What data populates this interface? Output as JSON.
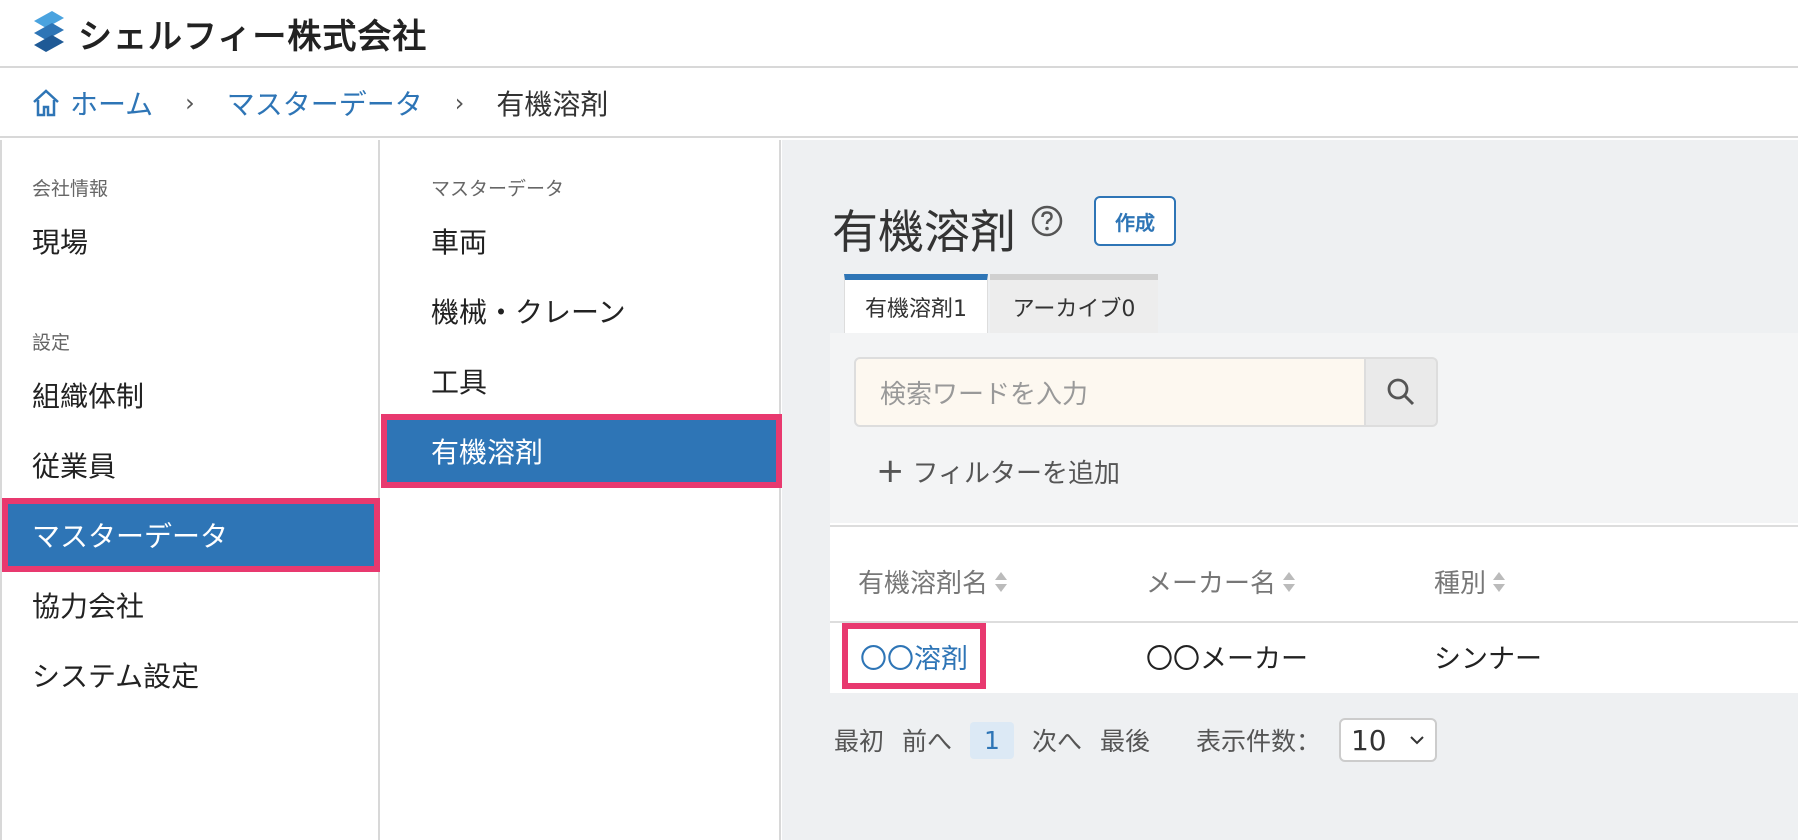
{
  "header": {
    "company": "シェルフィー株式会社"
  },
  "breadcrumb": {
    "home": "ホーム",
    "master": "マスターデータ",
    "current": "有機溶剤"
  },
  "sidebar1": {
    "company_section": "会社情報",
    "site": "現場",
    "settings_section": "設定",
    "org": "組織体制",
    "employees": "従業員",
    "master": "マスターデータ",
    "partner": "協力会社",
    "system": "システム設定"
  },
  "sidebar2": {
    "section": "マスターデータ",
    "items": [
      "車両",
      "機械・クレーン",
      "工具",
      "有機溶剤"
    ]
  },
  "main": {
    "title": "有機溶剤",
    "create": "作成",
    "tabs": [
      "有機溶剤1",
      "アーカイブ0"
    ],
    "search_placeholder": "検索ワードを入力",
    "add_filter": "フィルターを追加",
    "columns": [
      "有機溶剤名",
      "メーカー名",
      "種別"
    ],
    "rows": [
      [
        "〇〇溶剤",
        "〇〇メーカー",
        "シンナー"
      ]
    ],
    "pager": {
      "first": "最初",
      "prev": "前へ",
      "page": "1",
      "next": "次へ",
      "last": "最後",
      "per_page_label": "表示件数：",
      "per_page": "10"
    }
  },
  "colors": {
    "accent": "#2e75b6",
    "highlight": "#e8396f"
  }
}
